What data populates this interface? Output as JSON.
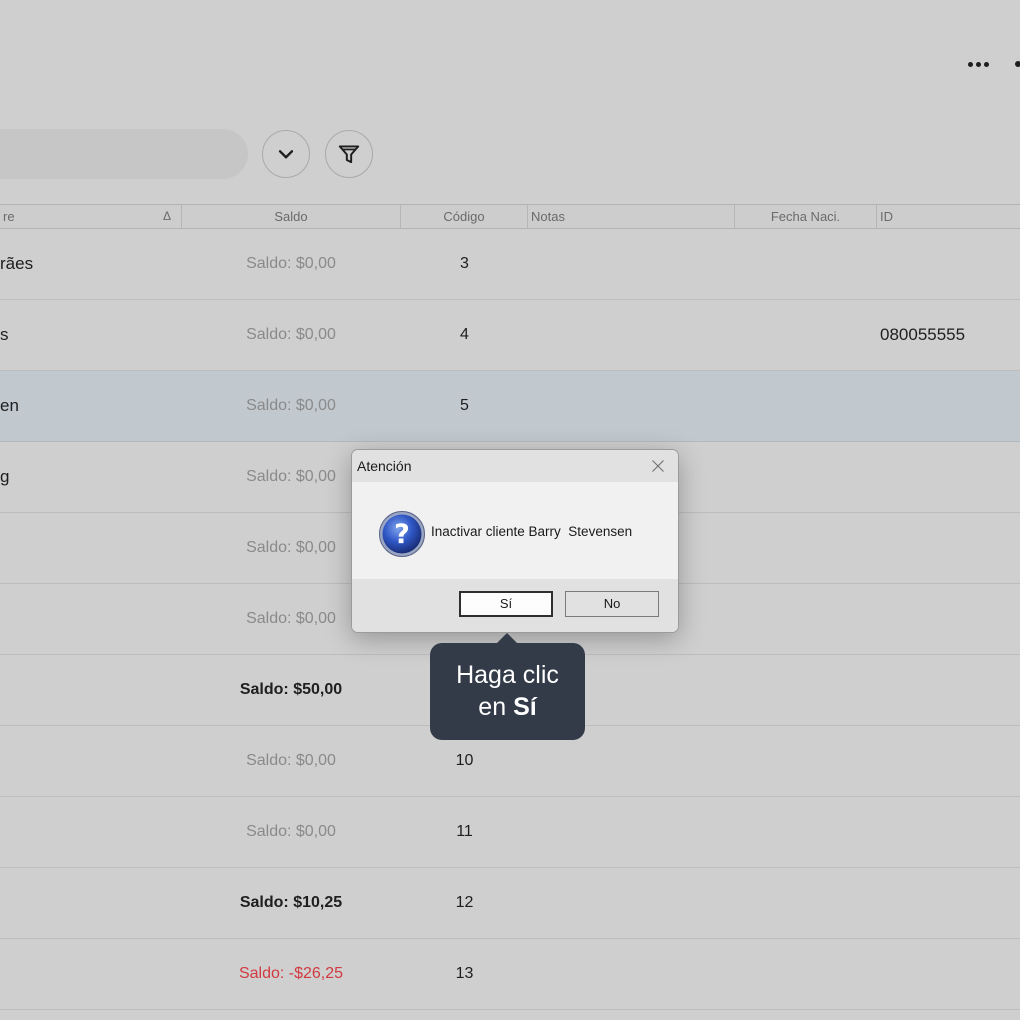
{
  "toolbar": {
    "more_icon": "more-horizontal-icon",
    "dropdown_icon": "chevron-down-icon",
    "filter_icon": "filter-icon"
  },
  "table": {
    "columns": {
      "nombre": "re",
      "nombre_sort_icon": "Δ",
      "saldo": "Saldo",
      "codigo": "Código",
      "notas": "Notas",
      "fecha": "Fecha Naci.",
      "id": "ID"
    },
    "rows": [
      {
        "name": "rães",
        "saldo": "Saldo: $0,00",
        "codigo": "3",
        "id": ""
      },
      {
        "name": "s",
        "saldo": "Saldo: $0,00",
        "codigo": "4",
        "id": "080055555"
      },
      {
        "name": "en",
        "saldo": "Saldo: $0,00",
        "codigo": "5",
        "id": ""
      },
      {
        "name": "g",
        "saldo": "Saldo: $0,00",
        "codigo": "",
        "id": ""
      },
      {
        "name": "",
        "saldo": "Saldo: $0,00",
        "codigo": "",
        "id": ""
      },
      {
        "name": "",
        "saldo": "Saldo: $0,00",
        "codigo": "",
        "id": ""
      },
      {
        "name": "",
        "saldo": "Saldo: $50,00",
        "codigo": "",
        "id": ""
      },
      {
        "name": "",
        "saldo": "Saldo: $0,00",
        "codigo": "10",
        "id": ""
      },
      {
        "name": "",
        "saldo": "Saldo: $0,00",
        "codigo": "11",
        "id": ""
      },
      {
        "name": "",
        "saldo": "Saldo: $10,25",
        "codigo": "12",
        "id": ""
      },
      {
        "name": "",
        "saldo": "Saldo: -$26,25",
        "codigo": "13",
        "id": ""
      }
    ]
  },
  "dialog": {
    "title": "Atención",
    "message": "Inactivar cliente Barry  Stevensen",
    "yes_label": "Sí",
    "no_label": "No"
  },
  "tooltip": {
    "line1": "Haga clic",
    "line2_prefix": "en ",
    "line2_bold": "Sí"
  },
  "colors": {
    "overlay_bg": "#cfcfcf",
    "selected_row": "#c1c9cf",
    "negative": "#d03a40",
    "tooltip_bg": "#333b48"
  }
}
